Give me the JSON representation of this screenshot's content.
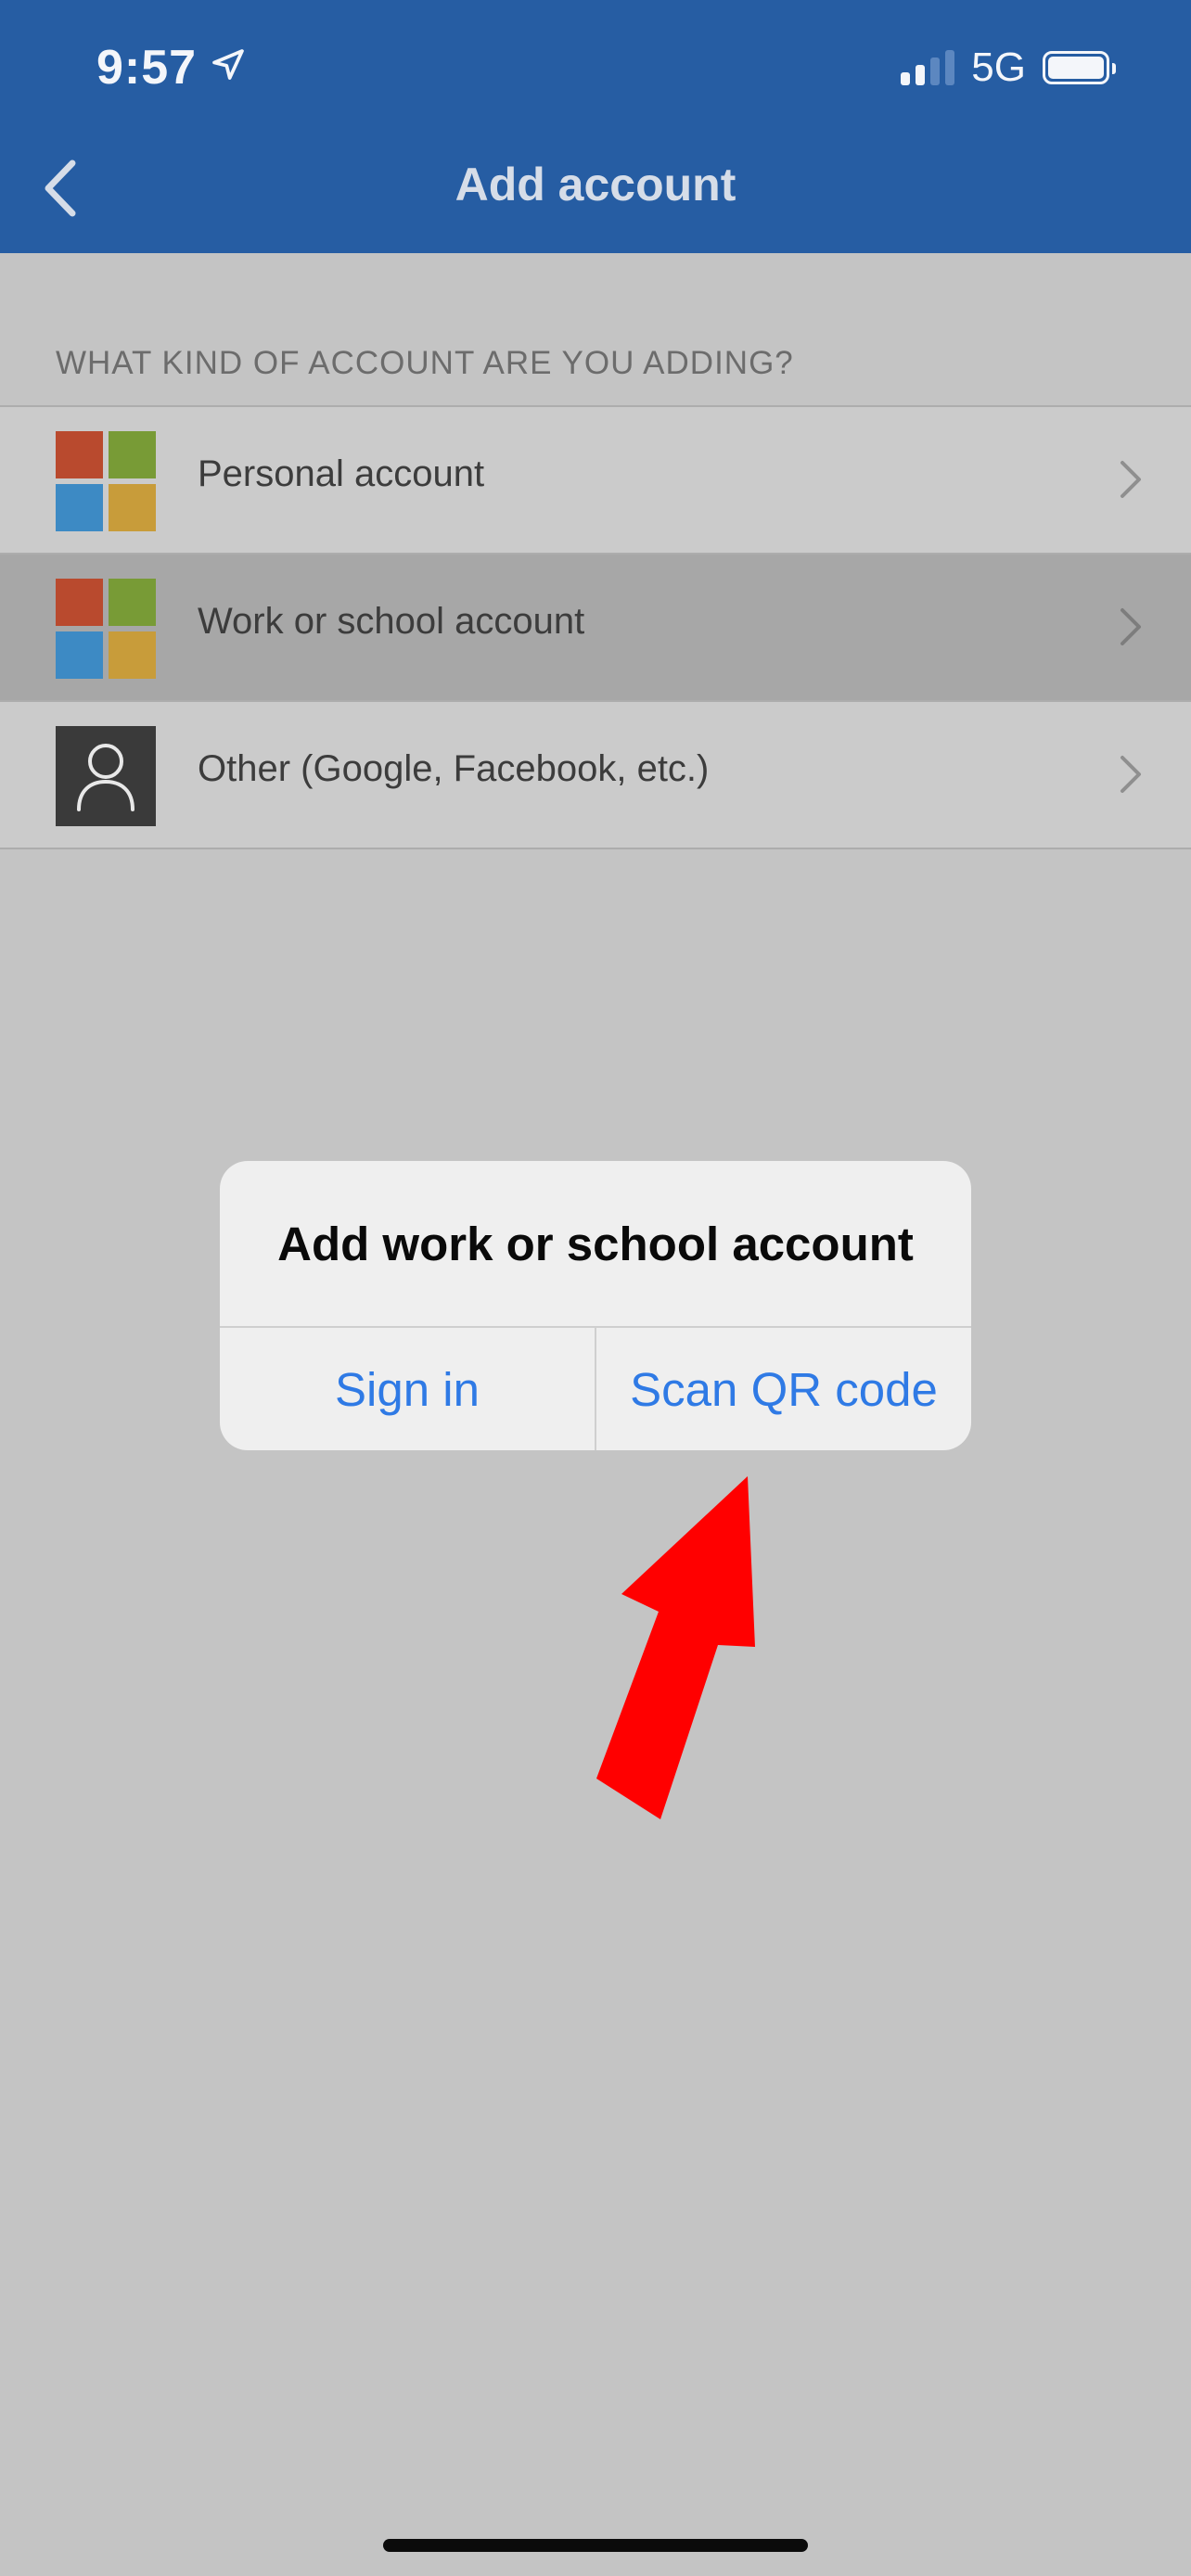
{
  "status_bar": {
    "time": "9:57",
    "location_icon": "location-arrow-icon",
    "network": "5G",
    "signal_bars_active": 2,
    "signal_bars_total": 4,
    "battery_level": 1.0
  },
  "nav": {
    "title": "Add account",
    "back_icon": "chevron-left-icon",
    "bar_color": "#265da3"
  },
  "section": {
    "header": "WHAT KIND OF ACCOUNT ARE YOU ADDING?"
  },
  "account_types": [
    {
      "label": "Personal account",
      "icon": "microsoft-logo-icon",
      "selected": false
    },
    {
      "label": "Work or school account",
      "icon": "microsoft-logo-icon",
      "selected": true
    },
    {
      "label": "Other (Google, Facebook, etc.)",
      "icon": "person-icon",
      "selected": false
    }
  ],
  "microsoft_logo_colors": [
    "#b94a2e",
    "#789b36",
    "#3d8ac4",
    "#c89c3a"
  ],
  "alert": {
    "title": "Add work or school account",
    "sign_in_label": "Sign in",
    "scan_qr_label": "Scan QR code",
    "button_color": "#2f7ae5"
  },
  "annotation": {
    "type": "arrow",
    "color": "#ff0000",
    "points_to": "Scan QR code"
  }
}
